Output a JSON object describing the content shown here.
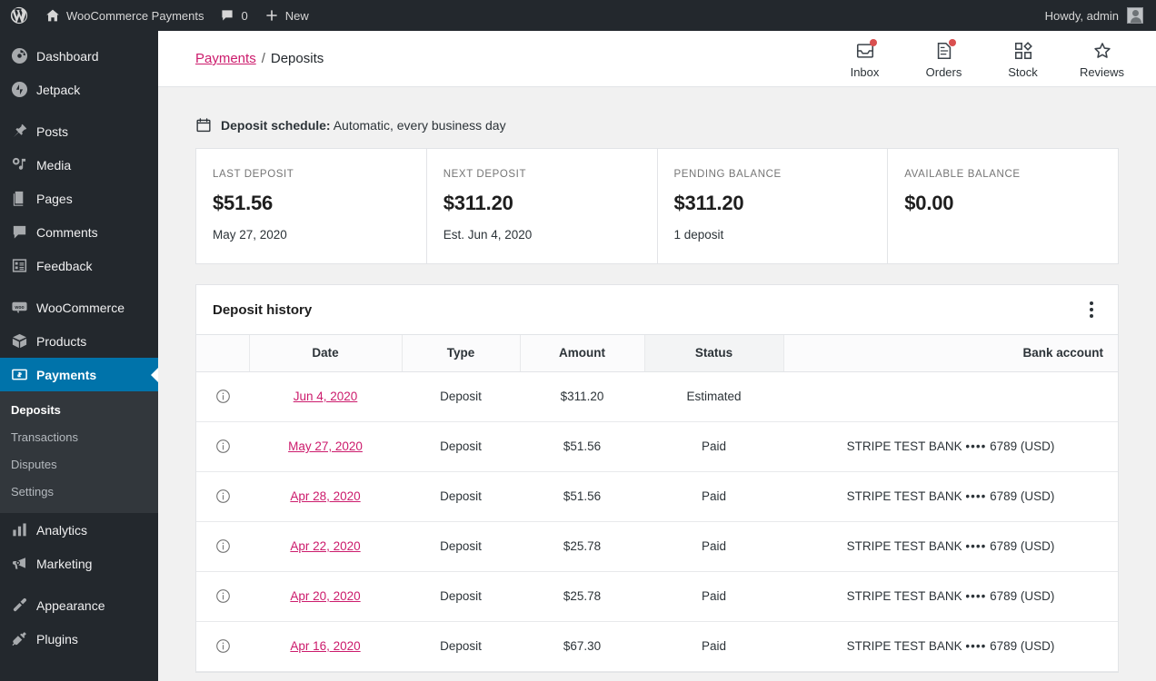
{
  "adminbar": {
    "site_title": "WooCommerce Payments",
    "comments_count": "0",
    "new_label": "New",
    "howdy": "Howdy, admin"
  },
  "sidebar": {
    "items": [
      {
        "label": "Dashboard",
        "icon": "dashboard-icon",
        "sep_before": false
      },
      {
        "label": "Jetpack",
        "icon": "jetpack-icon",
        "sep_before": false
      },
      {
        "label": "Posts",
        "icon": "pin-icon",
        "sep_before": true
      },
      {
        "label": "Media",
        "icon": "media-icon",
        "sep_before": false
      },
      {
        "label": "Pages",
        "icon": "pages-icon",
        "sep_before": false
      },
      {
        "label": "Comments",
        "icon": "comments-icon",
        "sep_before": false
      },
      {
        "label": "Feedback",
        "icon": "feedback-icon",
        "sep_before": false
      },
      {
        "label": "WooCommerce",
        "icon": "woo-icon",
        "sep_before": true
      },
      {
        "label": "Products",
        "icon": "products-icon",
        "sep_before": false
      },
      {
        "label": "Payments",
        "icon": "payments-icon",
        "sep_before": false,
        "current": true
      },
      {
        "label": "Analytics",
        "icon": "analytics-icon",
        "sep_before": false
      },
      {
        "label": "Marketing",
        "icon": "marketing-icon",
        "sep_before": false
      },
      {
        "label": "Appearance",
        "icon": "appearance-icon",
        "sep_before": true
      },
      {
        "label": "Plugins",
        "icon": "plugins-icon",
        "sep_before": false
      }
    ],
    "submenu": [
      {
        "label": "Deposits",
        "current": true
      },
      {
        "label": "Transactions",
        "current": false
      },
      {
        "label": "Disputes",
        "current": false
      },
      {
        "label": "Settings",
        "current": false
      }
    ],
    "highlight_color": "#0073aa"
  },
  "topbar": {
    "breadcrumb_parent": "Payments",
    "breadcrumb_sep": "/",
    "breadcrumb_current": "Deposits",
    "link_color": "#cc1b6c",
    "actions": [
      {
        "label": "Inbox",
        "icon": "inbox-icon",
        "badge": true
      },
      {
        "label": "Orders",
        "icon": "orders-icon",
        "badge": true
      },
      {
        "label": "Stock",
        "icon": "stock-icon",
        "badge": false
      },
      {
        "label": "Reviews",
        "icon": "reviews-star-icon",
        "badge": false
      }
    ],
    "badge_color": "#d94f4f"
  },
  "schedule": {
    "icon": "calendar-icon",
    "label": "Deposit schedule:",
    "value": "Automatic, every business day"
  },
  "cards": [
    {
      "label": "LAST DEPOSIT",
      "value": "$51.56",
      "sub": "May 27, 2020"
    },
    {
      "label": "NEXT DEPOSIT",
      "value": "$311.20",
      "sub": "Est. Jun 4, 2020"
    },
    {
      "label": "PENDING BALANCE",
      "value": "$311.20",
      "sub": "1 deposit"
    },
    {
      "label": "AVAILABLE BALANCE",
      "value": "$0.00",
      "sub": ""
    }
  ],
  "panel": {
    "title": "Deposit history",
    "menu_icon": "kebab-menu-icon"
  },
  "table": {
    "columns": [
      "Date",
      "Type",
      "Amount",
      "Status",
      "Bank account"
    ],
    "sorted_column": "Status",
    "rows": [
      {
        "info": "info-icon",
        "date": "Jun 4, 2020",
        "type": "Deposit",
        "amount": "$311.20",
        "status": "Estimated",
        "bank": ""
      },
      {
        "info": "info-icon",
        "date": "May 27, 2020",
        "type": "Deposit",
        "amount": "$51.56",
        "status": "Paid",
        "bank_name": "STRIPE TEST BANK",
        "bank_dots": "••••",
        "bank_tail": "6789 (USD)"
      },
      {
        "info": "info-icon",
        "date": "Apr 28, 2020",
        "type": "Deposit",
        "amount": "$51.56",
        "status": "Paid",
        "bank_name": "STRIPE TEST BANK",
        "bank_dots": "••••",
        "bank_tail": "6789 (USD)"
      },
      {
        "info": "info-icon",
        "date": "Apr 22, 2020",
        "type": "Deposit",
        "amount": "$25.78",
        "status": "Paid",
        "bank_name": "STRIPE TEST BANK",
        "bank_dots": "••••",
        "bank_tail": "6789 (USD)"
      },
      {
        "info": "info-icon",
        "date": "Apr 20, 2020",
        "type": "Deposit",
        "amount": "$25.78",
        "status": "Paid",
        "bank_name": "STRIPE TEST BANK",
        "bank_dots": "••••",
        "bank_tail": "6789 (USD)"
      },
      {
        "info": "info-icon",
        "date": "Apr 16, 2020",
        "type": "Deposit",
        "amount": "$67.30",
        "status": "Paid",
        "bank_name": "STRIPE TEST BANK",
        "bank_dots": "••••",
        "bank_tail": "6789 (USD)"
      }
    ]
  }
}
